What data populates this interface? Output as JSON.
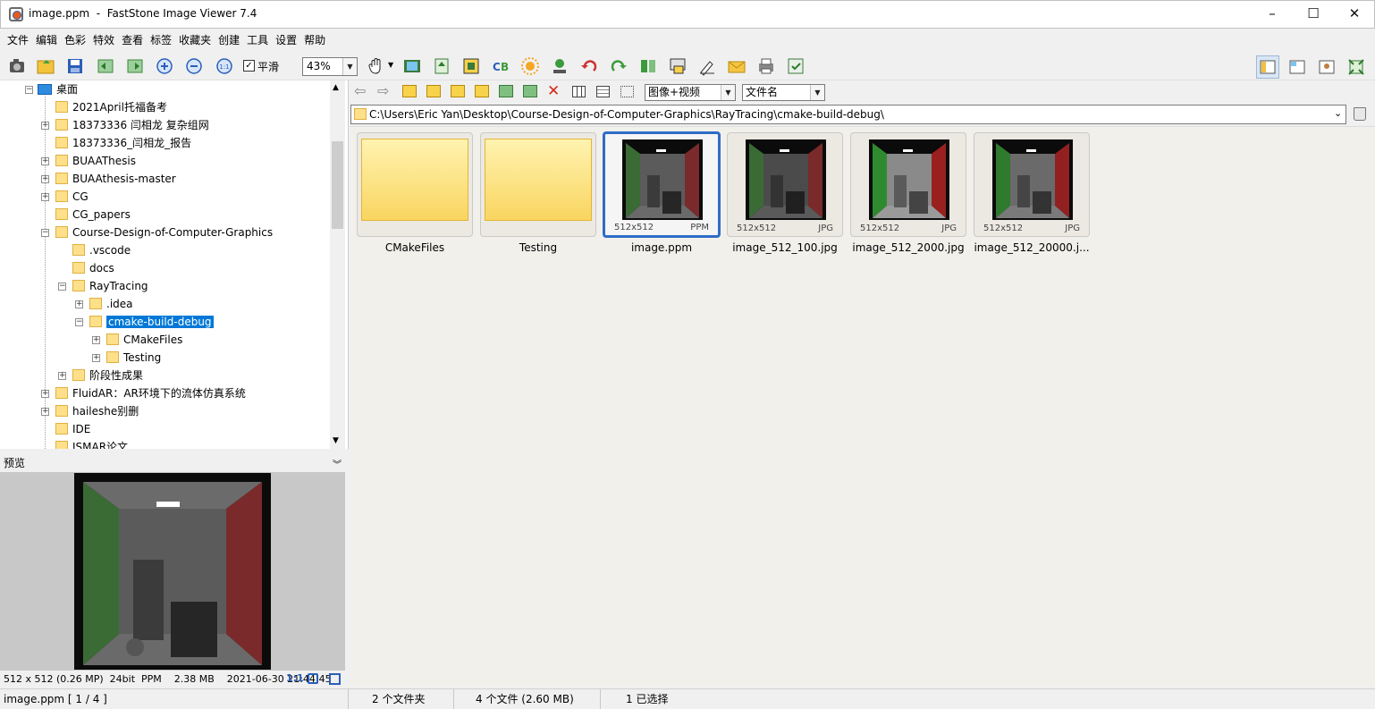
{
  "window": {
    "title": "image.ppm  -  FastStone Image Viewer 7.4",
    "minimize": "–",
    "maximize": "☐",
    "close": "✕"
  },
  "menu": [
    "文件",
    "编辑",
    "色彩",
    "特效",
    "查看",
    "标签",
    "收藏夹",
    "创建",
    "工具",
    "设置",
    "帮助"
  ],
  "toolbar": {
    "smooth_label": "平滑",
    "smooth_checked": "✓",
    "zoom_value": "43%"
  },
  "tree": {
    "root": "桌面",
    "items": [
      {
        "label": "2021April托福备考"
      },
      {
        "label": "18373336 闫相龙 复杂组网"
      },
      {
        "label": "18373336_闫相龙_报告"
      },
      {
        "label": "BUAAThesis"
      },
      {
        "label": "BUAAthesis-master"
      },
      {
        "label": "CG"
      },
      {
        "label": "CG_papers"
      },
      {
        "label": "Course-Design-of-Computer-Graphics"
      },
      {
        "label": ".vscode"
      },
      {
        "label": "docs"
      },
      {
        "label": "RayTracing"
      },
      {
        "label": ".idea"
      },
      {
        "label": "cmake-build-debug"
      },
      {
        "label": "CMakeFiles"
      },
      {
        "label": "Testing"
      },
      {
        "label": "阶段性成果"
      },
      {
        "label": "FluidAR：AR环境下的流体仿真系统"
      },
      {
        "label": "haileshe别删"
      },
      {
        "label": "IDE"
      },
      {
        "label": "ISMAR论文"
      }
    ]
  },
  "preview": {
    "header": "预览",
    "info": "512 x 512 (0.26 MP)  24bit  PPM    2.38 MB    2021-06-30 21:44:45",
    "ratio": "1:1"
  },
  "nav": {
    "filter": "图像+视频",
    "sort": "文件名"
  },
  "path": "C:\\Users\\Eric Yan\\Desktop\\Course-Design-of-Computer-Graphics\\RayTracing\\cmake-build-debug\\",
  "thumbs": [
    {
      "name": "CMakeFiles",
      "dim": "",
      "ext": ""
    },
    {
      "name": "Testing",
      "dim": "",
      "ext": ""
    },
    {
      "name": "image.ppm",
      "dim": "512x512",
      "ext": "PPM"
    },
    {
      "name": "image_512_100.jpg",
      "dim": "512x512",
      "ext": "JPG"
    },
    {
      "name": "image_512_2000.jpg",
      "dim": "512x512",
      "ext": "JPG"
    },
    {
      "name": "image_512_20000.j...",
      "dim": "512x512",
      "ext": "JPG"
    }
  ],
  "status": {
    "file": "image.ppm [ 1 / 4 ]",
    "folders": "2 个文件夹",
    "files": "4 个文件 (2.60 MB)",
    "selected": "1 已选择"
  }
}
